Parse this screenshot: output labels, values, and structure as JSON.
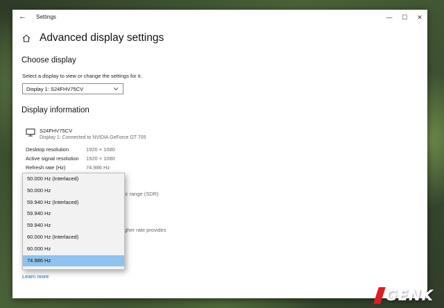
{
  "window": {
    "title": "Settings",
    "back": "←",
    "minimize": "—",
    "maximize": "☐",
    "close": "✕"
  },
  "page": {
    "title": "Advanced display settings"
  },
  "choose_display": {
    "heading": "Choose display",
    "instruction": "Select a display to view or change the settings for it.",
    "selected": "Display 1: S24FHV75CV"
  },
  "display_info": {
    "heading": "Display information",
    "monitor_name": "S24FHV75CV",
    "connection": "Display 1: Connected to NVIDIA GeForce GT 705",
    "rows": [
      {
        "label": "Desktop resolution",
        "value": "1920 × 1080"
      },
      {
        "label": "Active signal resolution",
        "value": "1920 × 1080"
      },
      {
        "label": "Refresh rate (Hz)",
        "value": "74.986 Hz"
      }
    ],
    "partial_sdr": "ic range (SDR)",
    "partial_rate": "gher rate provides"
  },
  "refresh_dropdown": {
    "options": [
      "50.000 Hz (Interlaced)",
      "50.000 Hz",
      "59.940 Hz (Interlaced)",
      "59.940 Hz",
      "59.940 Hz",
      "60.000 Hz (Interlaced)",
      "60.000 Hz",
      "74.986 Hz"
    ],
    "selected_index": 7
  },
  "learn_more": "Learn more",
  "watermark": "GENK",
  "icons": {
    "home": "home-icon",
    "monitor": "monitor-icon",
    "chevron": "chevron-down-icon"
  }
}
